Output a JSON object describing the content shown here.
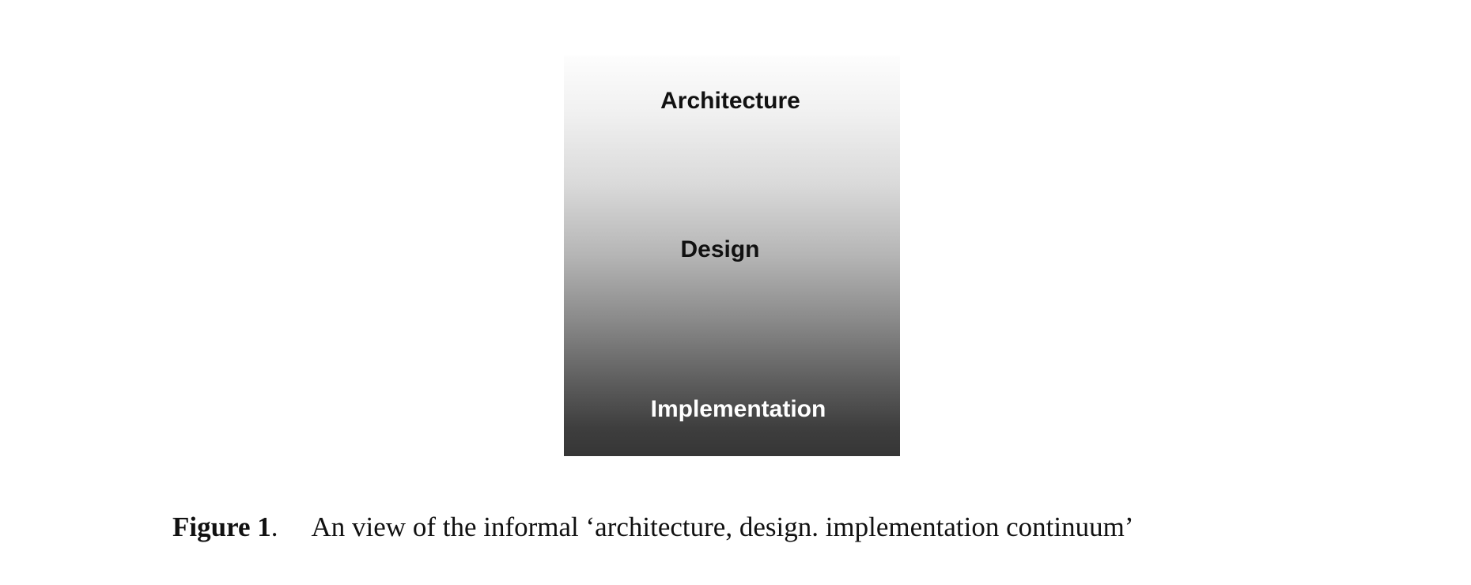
{
  "diagram": {
    "layers": {
      "top": "Architecture",
      "middle": "Design",
      "bottom": "Implementation"
    },
    "colors": {
      "gradient_top": "#fdfdfd",
      "gradient_bottom": "#363636",
      "dark_text": "#111111",
      "light_text": "#ffffff"
    }
  },
  "caption": {
    "label": "Figure 1",
    "separator": ".",
    "text": "An view of the informal ‘architecture, design. implementation continuum’"
  }
}
